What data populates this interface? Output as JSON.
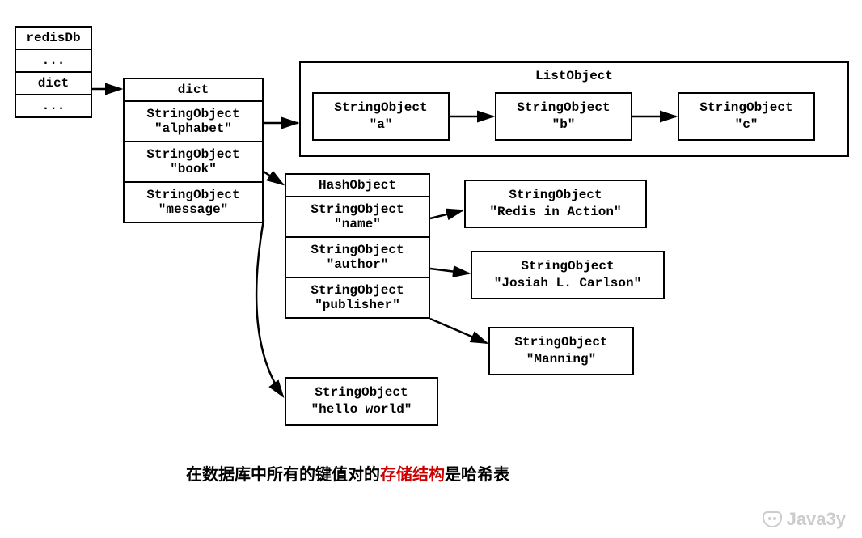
{
  "redisDb": {
    "title": "redisDb",
    "rows": [
      "...",
      "dict",
      "..."
    ]
  },
  "dict": {
    "title": "dict",
    "keys": [
      {
        "type": "StringObject",
        "value": "\"alphabet\""
      },
      {
        "type": "StringObject",
        "value": "\"book\""
      },
      {
        "type": "StringObject",
        "value": "\"message\""
      }
    ]
  },
  "listObject": {
    "title": "ListObject",
    "items": [
      {
        "type": "StringObject",
        "value": "\"a\""
      },
      {
        "type": "StringObject",
        "value": "\"b\""
      },
      {
        "type": "StringObject",
        "value": "\"c\""
      }
    ]
  },
  "hashObject": {
    "title": "HashObject",
    "fields": [
      {
        "key": {
          "type": "StringObject",
          "value": "\"name\""
        },
        "val": {
          "type": "StringObject",
          "value": "\"Redis in Action\""
        }
      },
      {
        "key": {
          "type": "StringObject",
          "value": "\"author\""
        },
        "val": {
          "type": "StringObject",
          "value": "\"Josiah L. Carlson\""
        }
      },
      {
        "key": {
          "type": "StringObject",
          "value": "\"publisher\""
        },
        "val": {
          "type": "StringObject",
          "value": "\"Manning\""
        }
      }
    ]
  },
  "messageValue": {
    "type": "StringObject",
    "value": "\"hello world\""
  },
  "caption": {
    "pre": "在数据库中所有的键值对的",
    "highlight": "存储结构",
    "post": "是哈希表"
  },
  "watermark": "Java3y"
}
